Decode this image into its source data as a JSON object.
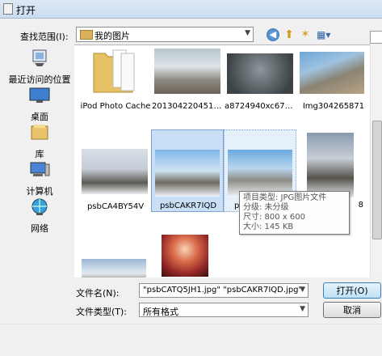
{
  "window": {
    "title": "打开"
  },
  "lookin": {
    "label": "查找范围(I):",
    "value": "我的图片"
  },
  "places": [
    {
      "label": "最近访问的位置",
      "icon": "recent-places-icon"
    },
    {
      "label": "桌面",
      "icon": "desktop-icon"
    },
    {
      "label": "库",
      "icon": "library-icon"
    },
    {
      "label": "计算机",
      "icon": "computer-icon"
    },
    {
      "label": "网络",
      "icon": "network-icon"
    }
  ],
  "files": [
    {
      "name": "iPod Photo Cache",
      "kind": "folder"
    },
    {
      "name": "20130422045114...",
      "kind": "image"
    },
    {
      "name": "a8724940xc67462...",
      "kind": "image"
    },
    {
      "name": "Img304265871",
      "kind": "image"
    },
    {
      "name": "psbCA4BY54V",
      "kind": "image"
    },
    {
      "name": "psbCAKR7IQD",
      "kind": "image",
      "state": "selected"
    },
    {
      "name": "psbCAT",
      "kind": "image",
      "state": "hover"
    },
    {
      "name": "8",
      "kind": "image"
    },
    {
      "name": "",
      "kind": "image"
    },
    {
      "name": "",
      "kind": "image"
    }
  ],
  "tooltip": {
    "type": "项目类型: JPG图片文件",
    "rating": "分级: 未分级",
    "dimensions": "尺寸: 800 x 600",
    "size": "大小: 145 KB"
  },
  "filename": {
    "label": "文件名(N):",
    "value": "\"psbCATQ5JH1.jpg\" \"psbCAKR7IQD.jpg\""
  },
  "filetype": {
    "label": "文件类型(T):",
    "value": "所有格式"
  },
  "buttons": {
    "open": "打开(O)",
    "cancel": "取消"
  },
  "colors": {
    "selection": "#c9dff6",
    "selection_border": "#7da2ce",
    "open_button": "#bfe1f7"
  }
}
